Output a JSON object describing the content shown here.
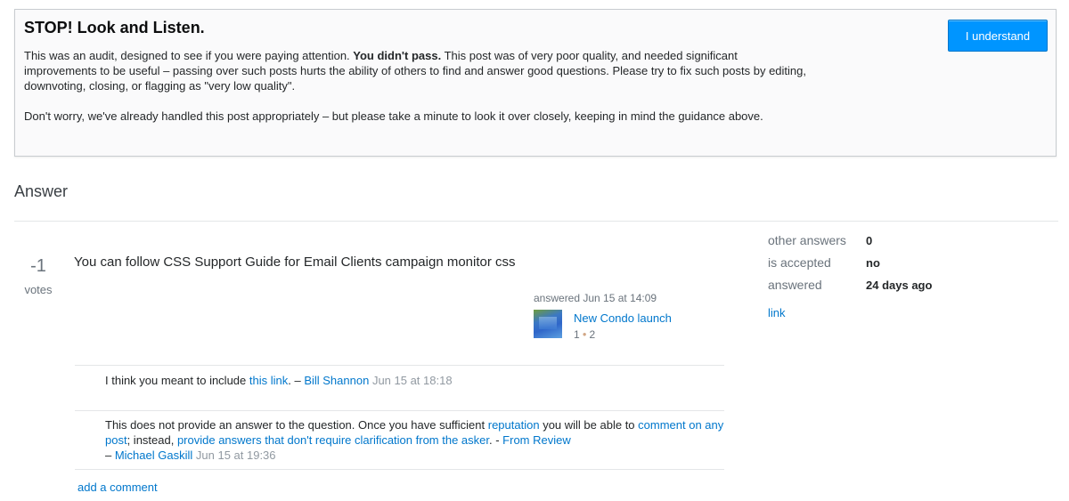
{
  "audit": {
    "title": "STOP! Look and Listen.",
    "para1_pre": "This was an audit, designed to see if you were paying attention. ",
    "para1_bold": "You didn't pass.",
    "para1_post": " This post was of very poor quality, and needed significant improvements to be useful – passing over such posts hurts the ability of others to find and answer good questions. Please try to fix such posts by editing, downvoting, closing, or flagging as \"very low quality\".",
    "para2": "Don't worry, we've already handled this post appropriately – but please take a minute to look it over closely, keeping in mind the guidance above.",
    "button_label": "I understand"
  },
  "section_title": "Answer",
  "answer": {
    "vote_count": "-1",
    "vote_label": "votes",
    "text": "You can follow CSS Support Guide for Email Clients campaign monitor css",
    "signature": {
      "action": "answered Jun 15 at 14:09",
      "user_name": "New Condo launch",
      "reputation": "1",
      "bronze_badges": "2"
    }
  },
  "stats": {
    "other_answers_label": "other answers",
    "other_answers_value": "0",
    "is_accepted_label": "is accepted",
    "is_accepted_value": "no",
    "answered_label": "answered",
    "answered_value": "24 days ago",
    "link_label": "link"
  },
  "comments": [
    {
      "text_pre": "I think you meant to include ",
      "link": "this link",
      "text_post": ". – ",
      "author": "Bill Shannon",
      "date": "Jun 15 at 18:18"
    },
    {
      "text_pre": "This does not provide an answer to the question. Once you have sufficient ",
      "link_reputation": "reputation",
      "text_mid1": " you will be able to ",
      "link_comment": "comment on any post",
      "text_mid2": "; instead, ",
      "link_provide": "provide answers that don't require clarification from the asker",
      "text_mid3": ". - ",
      "link_review": "From Review",
      "separator": "– ",
      "author": "Michael Gaskill",
      "date": "Jun 15 at 19:36"
    }
  ],
  "add_comment_label": "add a comment",
  "colors": {
    "accent": "#0095ff",
    "link": "#0077cc",
    "muted": "#6a737c",
    "bronze": "#d1a684"
  }
}
